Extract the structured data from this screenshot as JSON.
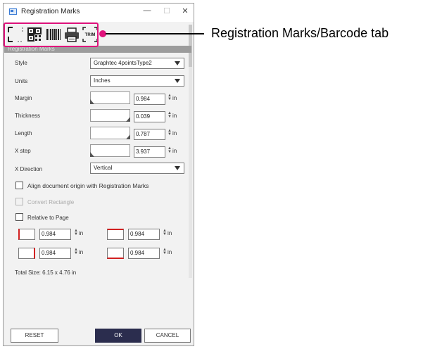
{
  "window": {
    "title": "Registration Marks",
    "controls": {
      "minimize": "—",
      "maximize": "☐",
      "close": "✕"
    }
  },
  "tabs": [
    {
      "icon": "registration-marks-icon"
    },
    {
      "icon": "qr-code-icon"
    },
    {
      "icon": "barcode-icon"
    },
    {
      "icon": "printer-icon"
    },
    {
      "icon": "trim-icon",
      "label": "TRIM"
    }
  ],
  "section": {
    "header": "Registration Marks"
  },
  "fields": {
    "style": {
      "label": "Style",
      "value": "Graphtec 4pointsType2"
    },
    "units": {
      "label": "Units",
      "value": "Inches"
    },
    "margin": {
      "label": "Margin",
      "value": "0.984",
      "unit": "in",
      "slider_level": 0.0
    },
    "thickness": {
      "label": "Thickness",
      "value": "0.039",
      "unit": "in",
      "slider_level": 1.0
    },
    "length": {
      "label": "Length",
      "value": "0.787",
      "unit": "in",
      "slider_level": 1.0
    },
    "x_step": {
      "label": "X step",
      "value": "3.937",
      "unit": "in",
      "slider_level": 0.0
    },
    "x_direction": {
      "label": "X Direction",
      "value": "Vertical"
    }
  },
  "checkboxes": {
    "align_origin": {
      "label": "Align document origin with Registration Marks",
      "checked": false,
      "enabled": true
    },
    "convert_rectangle": {
      "label": "Convert Rectangle",
      "checked": false,
      "enabled": false
    },
    "relative_to_page": {
      "label": "Relative to Page",
      "checked": false,
      "enabled": true
    }
  },
  "offsets": {
    "top_left": {
      "value": "0.984",
      "unit": "in"
    },
    "top_right": {
      "value": "0.984",
      "unit": "in"
    },
    "bottom_left": {
      "value": "0.984",
      "unit": "in"
    },
    "bottom_right": {
      "value": "0.984",
      "unit": "in"
    }
  },
  "total_size": "Total Size: 6.15 x 4.76 in",
  "buttons": {
    "reset": "RESET",
    "ok": "OK",
    "cancel": "CANCEL"
  },
  "annotation": {
    "text": "Registration Marks/Barcode tab",
    "color": "#e0127c"
  },
  "colors": {
    "ok_button": "#2b2d4e",
    "highlight": "#e0127c",
    "header_bar": "#9c9c9c",
    "marker": "#d22020"
  }
}
